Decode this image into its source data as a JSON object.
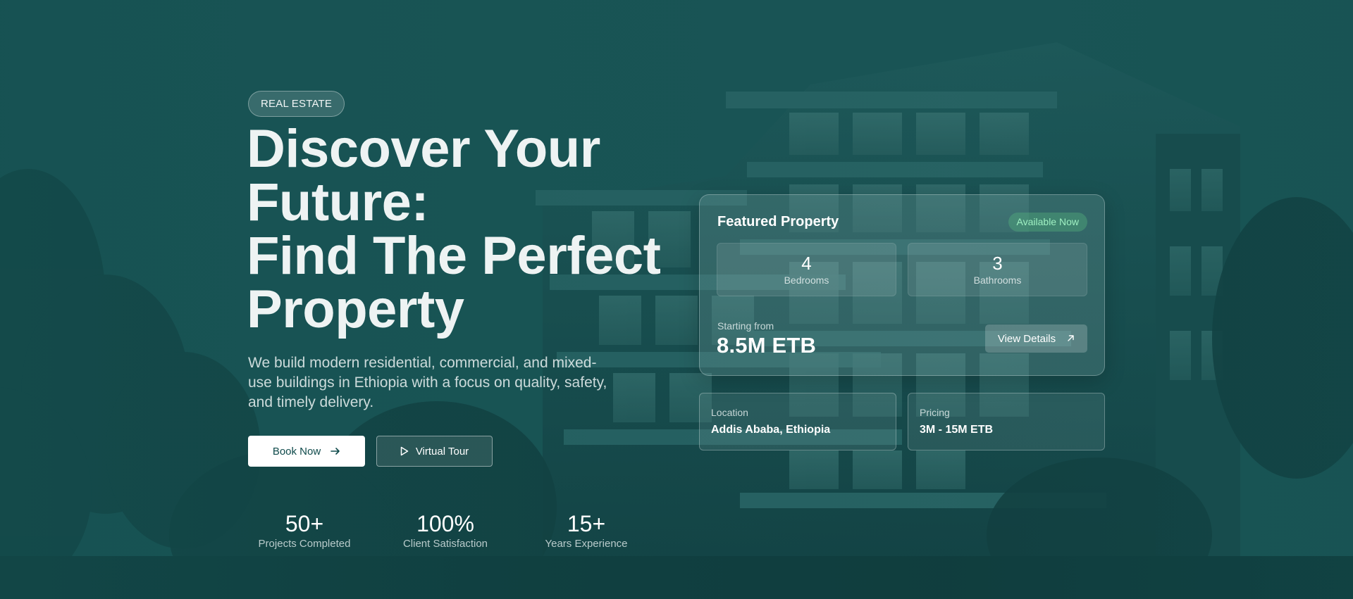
{
  "hero": {
    "badge": "REAL ESTATE",
    "headline_lines": [
      "Discover Your",
      "Future:",
      "Find The Perfect",
      "Property"
    ],
    "lead": "We build modern residential, commercial, and mixed-use buildings in Ethiopia with a focus on quality, safety, and timely delivery.",
    "primary_button": {
      "label": "Book Now",
      "icon": "arrow-right-icon"
    },
    "secondary_button": {
      "label": "Virtual Tour",
      "icon": "play-icon"
    },
    "stats": [
      {
        "value": "50+",
        "label": "Projects Completed"
      },
      {
        "value": "100%",
        "label": "Client Satisfaction"
      },
      {
        "value": "15+",
        "label": "Years Experience"
      }
    ]
  },
  "featured": {
    "title": "Featured Property",
    "status": "Available Now",
    "bedrooms": {
      "value": "4",
      "label": "Bedrooms"
    },
    "bathrooms": {
      "value": "3",
      "label": "Bathrooms"
    },
    "starting_label": "Starting from",
    "price": "8.5M ETB",
    "details_button": {
      "label": "View Details",
      "icon": "arrow-up-right-icon"
    }
  },
  "info": {
    "location": {
      "label": "Location",
      "value": "Addis Ababa, Ethiopia"
    },
    "pricing": {
      "label": "Pricing",
      "value": "3M - 15M ETB"
    }
  },
  "colors": {
    "background": "#164f51",
    "accent_green": "#9ff0c2",
    "button_text": "#0f4a4b"
  }
}
